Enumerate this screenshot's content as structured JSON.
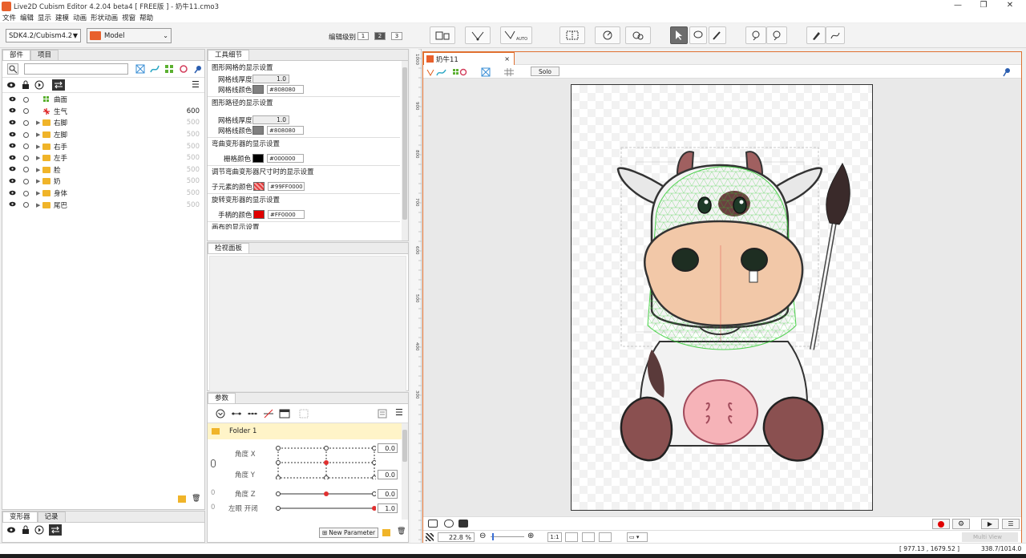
{
  "window": {
    "title": "Live2D Cubism Editor 4.2.04 beta4   [ FREE版 ] - 奶牛11.cmo3",
    "min_glyph": "—",
    "max_glyph": "❐",
    "close_glyph": "✕"
  },
  "menu": [
    "文件",
    "编辑",
    "显示",
    "建模",
    "动画",
    "形状动画",
    "视窗",
    "帮助"
  ],
  "toolbar": {
    "sdk_value": "SDK4.2/Cubism4.2",
    "mode_value": "Model",
    "edit_level_label": "编辑级别 :",
    "levels": [
      "1",
      "2",
      "3"
    ],
    "active_level": "2"
  },
  "parts_panel": {
    "tabs": [
      "部件",
      "项目"
    ],
    "search_placeholder": "",
    "items": [
      {
        "name": "曲面",
        "value": "",
        "type": "mesh"
      },
      {
        "name": "生气",
        "value": "600",
        "type": "deform"
      },
      {
        "name": "右脚",
        "value": "500",
        "type": "folder"
      },
      {
        "name": "左脚",
        "value": "500",
        "type": "folder"
      },
      {
        "name": "右手",
        "value": "500",
        "type": "folder"
      },
      {
        "name": "左手",
        "value": "500",
        "type": "folder"
      },
      {
        "name": "脸",
        "value": "500",
        "type": "folder"
      },
      {
        "name": "奶",
        "value": "500",
        "type": "folder"
      },
      {
        "name": "身体",
        "value": "500",
        "type": "folder"
      },
      {
        "name": "尾巴",
        "value": "500",
        "type": "folder"
      }
    ]
  },
  "deformer_panel": {
    "tabs": [
      "变形器",
      "记录"
    ]
  },
  "tool_detail": {
    "tab": "工具细节",
    "mesh_header": "图形网格的显示设置",
    "mesh_thickness_label": "网格线厚度",
    "mesh_thickness": "1.0",
    "mesh_color_label": "网格线颜色",
    "mesh_color": "#808080",
    "path_header": "图形路径的显示设置",
    "path_thickness_label": "网格线厚度",
    "path_thickness": "1.0",
    "path_color_label": "网格线颜色",
    "path_color": "#808080",
    "warp_header": "弯曲变形器的显示设置",
    "warp_grid_label": "栅格颜色",
    "warp_grid_color": "#000000",
    "warp_resize_header": "调节弯曲变形器尺寸时的显示设置",
    "warp_child_label": "子元素的颜色",
    "warp_child_color": "#99FF0000",
    "rot_header": "旋转变形器的显示设置",
    "rot_handle_label": "手柄的颜色",
    "rot_handle_color": "#FF0000",
    "canvas_header": "画布的显示设置"
  },
  "inspector": {
    "tab": "检视面板"
  },
  "params": {
    "tab": "参数",
    "folder": "Folder 1",
    "new_param_label": "New Parameter",
    "rows": [
      {
        "name": "角度 X",
        "value": "0.0"
      },
      {
        "name": "角度 Y",
        "value": "0.0"
      },
      {
        "name": "角度 Z",
        "value": "0.0"
      },
      {
        "name": "左眼  开闭",
        "value": "1.0"
      }
    ],
    "left_marks": [
      "0",
      "0"
    ]
  },
  "viewport": {
    "tab_title": "奶牛11",
    "solo_label": "Solo",
    "zoom_value": "22.8 %",
    "scale_button": "1:1",
    "ruler_ticks": [
      "1000",
      "900",
      "800",
      "700",
      "600",
      "500",
      "400",
      "300"
    ],
    "multi_view": "Multi View",
    "mesh_color": "#33cc33",
    "accent_color": "#e06020"
  },
  "status": {
    "coords": "[  977.13 ,  1679.52 ]",
    "scale": "338.7/1014.0"
  }
}
